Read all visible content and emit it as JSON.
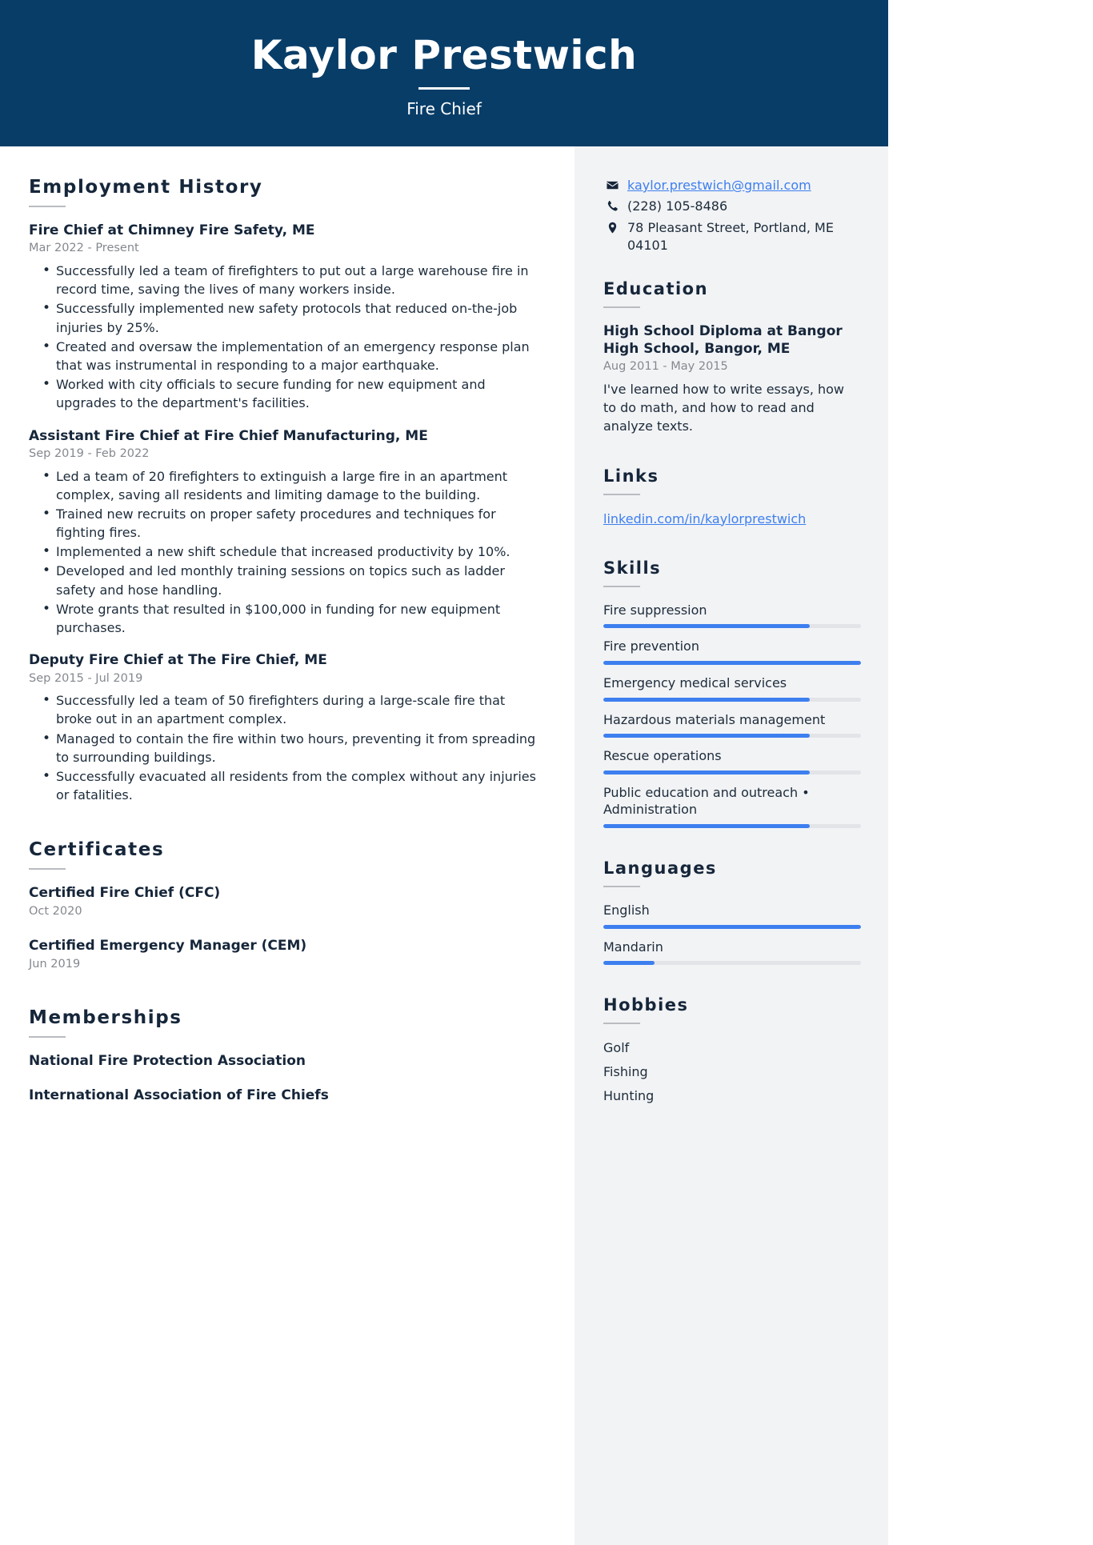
{
  "header": {
    "name": "Kaylor Prestwich",
    "job_title": "Fire Chief",
    "background_color": "#083d68"
  },
  "theme": {
    "accent_color": "#3d7fef",
    "sidebar_background": "#f2f3f5",
    "text_color": "#1c2b3a",
    "muted_text_color": "#84888e"
  },
  "main": {
    "employment": {
      "heading": "Employment History",
      "entries": [
        {
          "title": "Fire Chief at Chimney Fire Safety, ME",
          "date": "Mar 2022 - Present",
          "bullets": [
            "Successfully led a team of firefighters to put out a large warehouse fire in record time, saving the lives of many workers inside.",
            "Successfully implemented new safety protocols that reduced on-the-job injuries by 25%.",
            "Created and oversaw the implementation of an emergency response plan that was instrumental in responding to a major earthquake.",
            "Worked with city officials to secure funding for new equipment and upgrades to the department's facilities."
          ]
        },
        {
          "title": "Assistant Fire Chief at Fire Chief Manufacturing, ME",
          "date": "Sep 2019 - Feb 2022",
          "bullets": [
            "Led a team of 20 firefighters to extinguish a large fire in an apartment complex, saving all residents and limiting damage to the building.",
            "Trained new recruits on proper safety procedures and techniques for fighting fires.",
            "Implemented a new shift schedule that increased productivity by 10%.",
            "Developed and led monthly training sessions on topics such as ladder safety and hose handling.",
            "Wrote grants that resulted in $100,000 in funding for new equipment purchases."
          ]
        },
        {
          "title": "Deputy Fire Chief at The Fire Chief, ME",
          "date": "Sep 2015 - Jul 2019",
          "bullets": [
            "Successfully led a team of 50 firefighters during a large-scale fire that broke out in an apartment complex.",
            "Managed to contain the fire within two hours, preventing it from spreading to surrounding buildings.",
            "Successfully evacuated all residents from the complex without any injuries or fatalities."
          ]
        }
      ]
    },
    "certificates": {
      "heading": "Certificates",
      "entries": [
        {
          "title": "Certified Fire Chief (CFC)",
          "date": "Oct 2020"
        },
        {
          "title": "Certified Emergency Manager (CEM)",
          "date": "Jun 2019"
        }
      ]
    },
    "memberships": {
      "heading": "Memberships",
      "entries": [
        {
          "title": "National Fire Protection Association"
        },
        {
          "title": "International Association of Fire Chiefs"
        }
      ]
    }
  },
  "sidebar": {
    "contact": [
      {
        "icon": "envelope-icon",
        "text": "kaylor.prestwich@gmail.com",
        "is_link": true
      },
      {
        "icon": "phone-icon",
        "text": "(228) 105-8486",
        "is_link": false
      },
      {
        "icon": "map-pin-icon",
        "text": "78 Pleasant Street, Portland, ME 04101",
        "is_link": false
      }
    ],
    "education": {
      "heading": "Education",
      "entries": [
        {
          "title": "High School Diploma at Bangor High School, Bangor, ME",
          "date": "Aug 2011 - May 2015",
          "description": "I've learned how to write essays, how to do math, and how to read and analyze texts."
        }
      ]
    },
    "links": {
      "heading": "Links",
      "items": [
        {
          "label": "linkedin.com/in/kaylorprestwich"
        }
      ]
    },
    "skills": {
      "heading": "Skills",
      "items": [
        {
          "label": "Fire suppression",
          "level": 80
        },
        {
          "label": "Fire prevention",
          "level": 100
        },
        {
          "label": "Emergency medical services",
          "level": 80
        },
        {
          "label": "Hazardous materials management",
          "level": 80
        },
        {
          "label": "Rescue operations",
          "level": 80
        },
        {
          "label": "Public education and outreach  •  Administration",
          "level": 80
        }
      ]
    },
    "languages": {
      "heading": "Languages",
      "items": [
        {
          "label": "English",
          "level": 100
        },
        {
          "label": "Mandarin",
          "level": 20
        }
      ]
    },
    "hobbies": {
      "heading": "Hobbies",
      "items": [
        {
          "label": "Golf"
        },
        {
          "label": "Fishing"
        },
        {
          "label": "Hunting"
        }
      ]
    }
  }
}
